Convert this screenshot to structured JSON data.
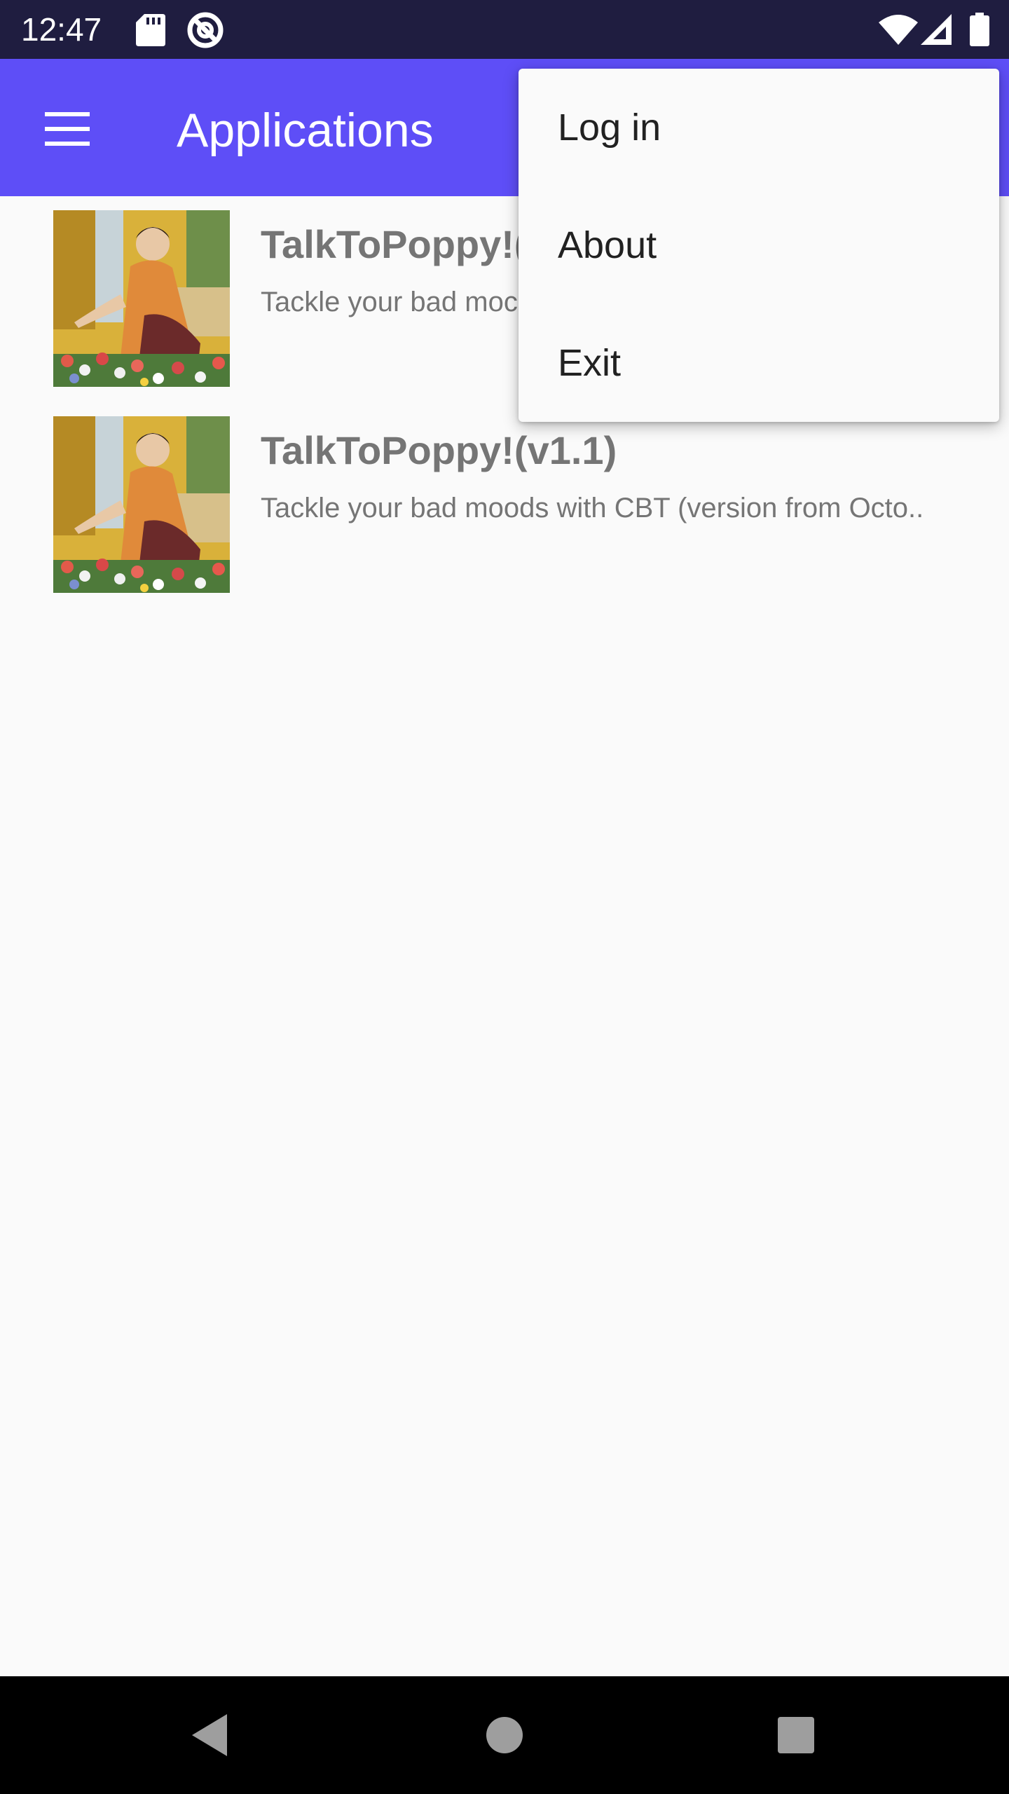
{
  "status_bar": {
    "time": "12:47",
    "left_icons": [
      "sd-card-icon",
      "no-disturb-icon"
    ],
    "right_icons": [
      "wifi-icon",
      "signal-icon",
      "battery-icon"
    ]
  },
  "app_bar": {
    "title": "Applications",
    "nav_icon": "menu-icon",
    "color": "#5e4ef7"
  },
  "apps": [
    {
      "title": "TalkToPoppy!(v",
      "subtitle": "Tackle your bad moc",
      "thumbnail": "painting-thumbnail"
    },
    {
      "title": "TalkToPoppy!(v1.1)",
      "subtitle": "Tackle your bad moods with CBT (version from Octo..",
      "thumbnail": "painting-thumbnail"
    }
  ],
  "overflow_menu": {
    "items": [
      {
        "label": "Log in"
      },
      {
        "label": "About"
      },
      {
        "label": "Exit"
      }
    ]
  },
  "nav_bar": {
    "icons": [
      "back-icon",
      "home-icon",
      "recents-icon"
    ]
  }
}
